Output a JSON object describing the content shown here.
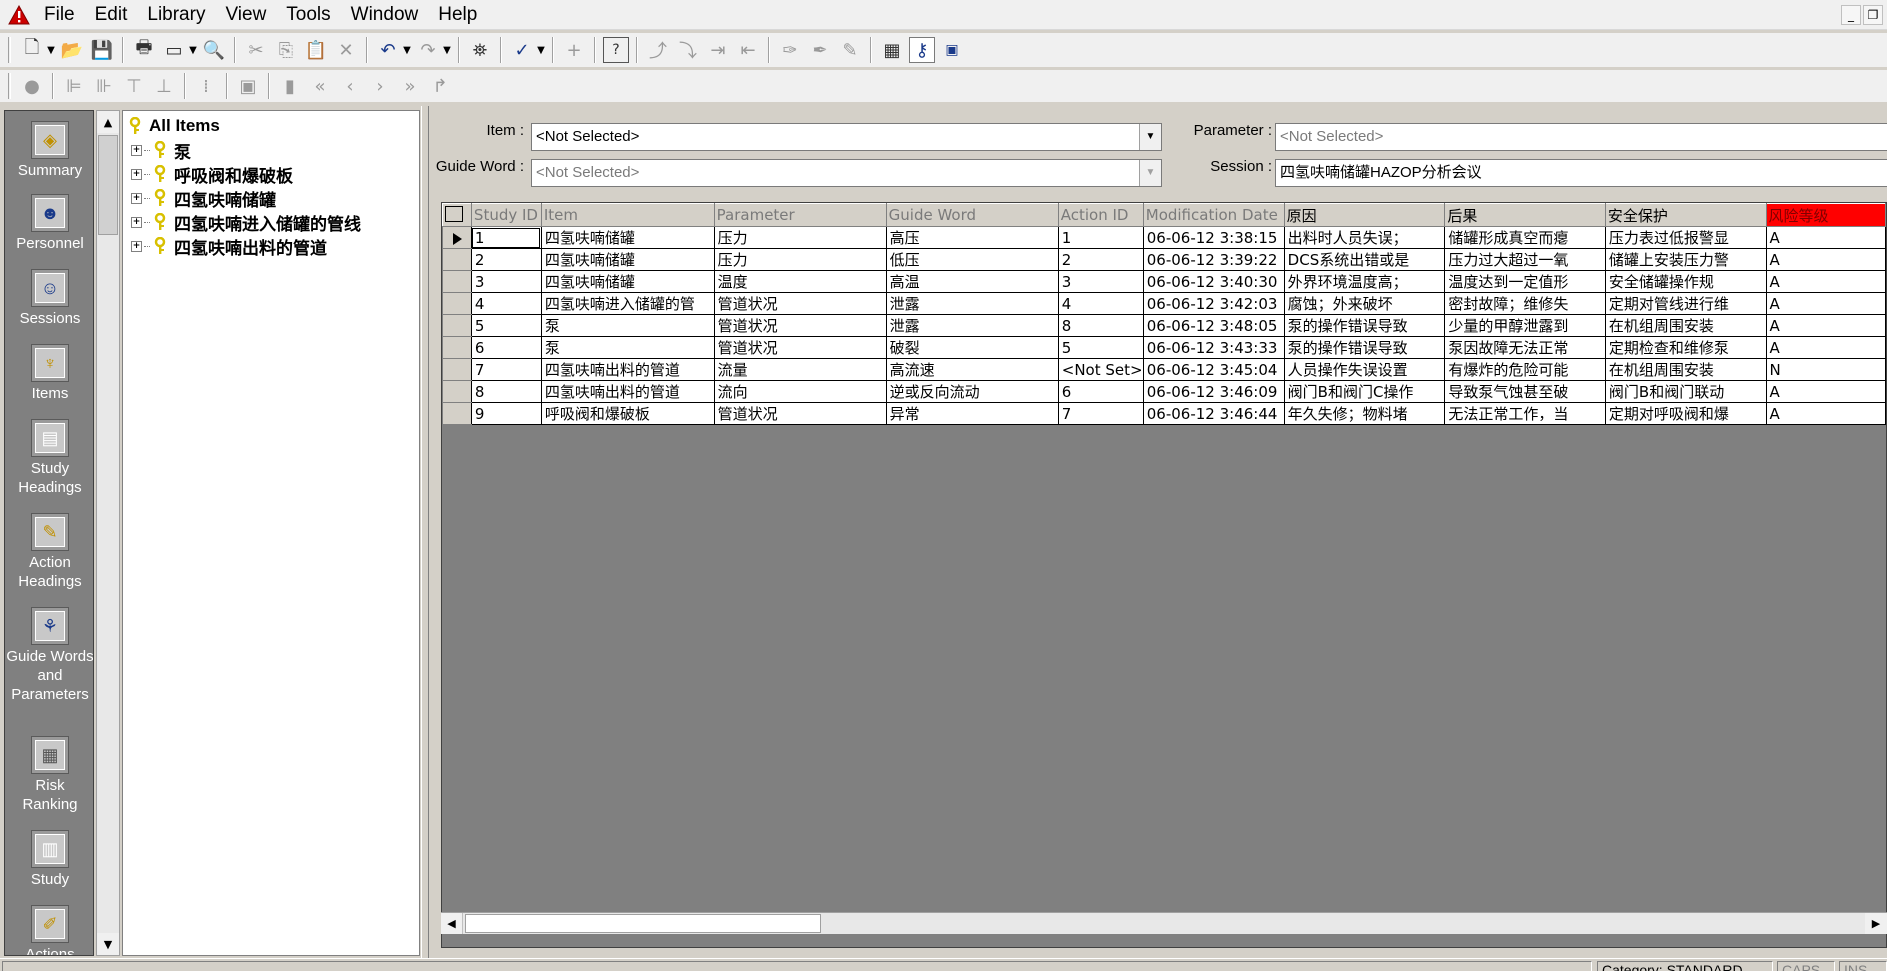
{
  "menu": [
    "File",
    "Edit",
    "Library",
    "View",
    "Tools",
    "Window",
    "Help"
  ],
  "tree": {
    "root": "All Items",
    "items": [
      "泵",
      "呼吸阀和爆破板",
      "四氢呋喃储罐",
      "四氢呋喃进入储罐的管线",
      "四氢呋喃出料的管道"
    ]
  },
  "nav": [
    {
      "label": "Summary",
      "icon": "summary-icon",
      "glyph": "◈"
    },
    {
      "label": "Personnel",
      "icon": "personnel-icon",
      "glyph": "☻"
    },
    {
      "label": "Sessions",
      "icon": "sessions-icon",
      "glyph": "☺"
    },
    {
      "label": "Items",
      "icon": "items-icon",
      "glyph": "♆"
    },
    {
      "label": "Study Headings",
      "icon": "study-headings-icon",
      "glyph": "▤"
    },
    {
      "label": "Action Headings",
      "icon": "action-headings-icon",
      "glyph": "✎"
    },
    {
      "label": "Guide Words and Parameters",
      "icon": "guide-words-icon",
      "glyph": "⚘"
    },
    {
      "label": "Risk Ranking",
      "icon": "risk-ranking-icon",
      "glyph": "▦"
    },
    {
      "label": "Study",
      "icon": "study-icon",
      "glyph": "▥"
    },
    {
      "label": "Actions",
      "icon": "actions-icon",
      "glyph": "✐"
    }
  ],
  "filters": {
    "item_label": "Item :",
    "item_value": "<Not Selected>",
    "guide_label": "Guide Word :",
    "guide_value": "<Not Selected>",
    "param_label": "Parameter :",
    "param_value": "<Not Selected>",
    "session_label": "Session :",
    "session_value": "四氢呋喃储罐HAZOP分析会议"
  },
  "grid": {
    "columns": [
      "Study ID",
      "Item",
      "Parameter",
      "Guide Word",
      "Action ID",
      "Modification Date",
      "原因",
      "后果",
      "安全保护",
      "风险等级"
    ],
    "rows": [
      [
        "1",
        "四氢呋喃储罐",
        "压力",
        "高压",
        "1",
        "06-06-12 3:38:15",
        "出料时人员失误；",
        "储罐形成真空而瘪",
        "压力表过低报警显",
        "A"
      ],
      [
        "2",
        "四氢呋喃储罐",
        "压力",
        "低压",
        "2",
        "06-06-12 3:39:22",
        "DCS系统出错或是",
        "压力过大超过一氧",
        "储罐上安装压力警",
        "A"
      ],
      [
        "3",
        "四氢呋喃储罐",
        "温度",
        "高温",
        "3",
        "06-06-12 3:40:30",
        "外界环境温度高；",
        "温度达到一定值形",
        "安全储罐操作规",
        "A"
      ],
      [
        "4",
        "四氢呋喃进入储罐的管",
        "管道状况",
        "泄露",
        "4",
        "06-06-12 3:42:03",
        "腐蚀；外来破坏",
        "密封故障；维修失",
        "定期对管线进行维",
        "A"
      ],
      [
        "5",
        "泵",
        "管道状况",
        "泄露",
        "8",
        "06-06-12 3:48:05",
        "泵的操作错误导致",
        "少量的甲醇泄露到",
        "在机组周围安装",
        "A"
      ],
      [
        "6",
        "泵",
        "管道状况",
        "破裂",
        "5",
        "06-06-12 3:43:33",
        "泵的操作错误导致",
        "泵因故障无法正常",
        "定期检查和维修泵",
        "A"
      ],
      [
        "7",
        "四氢呋喃出料的管道",
        "流量",
        "高流速",
        "<Not Set>",
        "06-06-12 3:45:04",
        "人员操作失误设置",
        "有爆炸的危险可能",
        "在机组周围安装",
        "N"
      ],
      [
        "8",
        "四氢呋喃出料的管道",
        "流向",
        "逆或反向流动",
        "6",
        "06-06-12 3:46:09",
        "阀门B和阀门C操作",
        "导致泵气蚀甚至破",
        "阀门B和阀门联动",
        "A"
      ],
      [
        "9",
        "呼吸阀和爆破板",
        "管道状况",
        "异常",
        "7",
        "06-06-12 3:46:44",
        "年久失修；物料堵",
        "无法正常工作，当",
        "定期对呼吸阀和爆",
        "A"
      ]
    ]
  },
  "status": {
    "category": "Category: STANDARD",
    "caps": "CAPS",
    "ins": "INS"
  },
  "colors": {
    "risk_header": "#ff0000",
    "nav_bg": "#808080",
    "app_icon": "#cc0000",
    "key_icon": "#d8c000"
  },
  "icons": {
    "app": "warning-triangle-icon",
    "tree_node": "key-icon"
  }
}
